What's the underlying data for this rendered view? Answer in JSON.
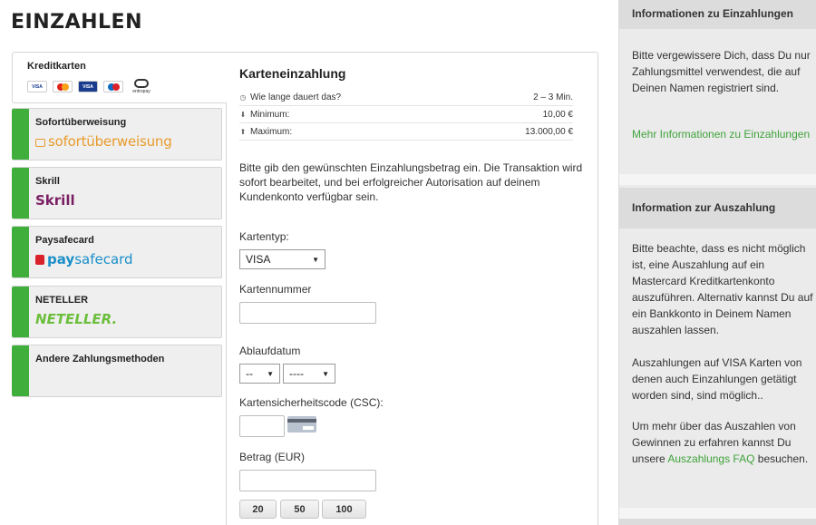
{
  "page": {
    "title": "EINZAHLEN"
  },
  "methods": {
    "active": {
      "label": "Kreditkarten",
      "card_logos": [
        "VISA",
        "Mastercard",
        "VISA Electron",
        "Maestro",
        "entropay"
      ]
    },
    "items": [
      {
        "label": "Sofortüberweisung",
        "logo_text": "sofortüberweisung"
      },
      {
        "label": "Skrill",
        "logo_text": "Skrill"
      },
      {
        "label": "Paysafecard",
        "logo_text_bold": "pay",
        "logo_text_rest": "safecard"
      },
      {
        "label": "NETELLER",
        "logo_text": "NETELLER."
      },
      {
        "label": "Andere Zahlungsmethoden"
      }
    ],
    "accent_color": "#3fae3a"
  },
  "form": {
    "title": "Karteneinzahlung",
    "info": [
      {
        "label": "Wie lange dauert das?",
        "value": "2 – 3 Min.",
        "icon": "clock-icon"
      },
      {
        "label": "Minimum:",
        "value": "10,00 €",
        "icon": "arrow-down-icon"
      },
      {
        "label": "Maximum:",
        "value": "13.000,00 €",
        "icon": "arrow-up-icon"
      }
    ],
    "description": "Bitte gib den gewünschten Einzahlungsbetrag ein. Die Transaktion wird sofort bearbeitet, und bei erfolgreicher Autorisation auf deinem Kundenkonto verfügbar sein.",
    "card_type_label": "Kartentyp:",
    "card_type_value": "VISA",
    "card_number_label": "Kartennummer",
    "card_number_value": "",
    "expiry_label": "Ablaufdatum",
    "expiry_month_value": "--",
    "expiry_year_value": "----",
    "csc_label": "Kartensicherheitscode (CSC):",
    "csc_value": "",
    "amount_label": "Betrag (EUR)",
    "amount_value": "",
    "quick_amounts": [
      "20",
      "50",
      "100"
    ]
  },
  "sidebar": {
    "deposit_info": {
      "title": "Informationen zu Einzahlungen",
      "text": "Bitte vergewissere Dich, dass Du nur Zahlungsmittel verwendest, die auf Deinen Namen registriert sind.",
      "link": "Mehr Informationen zu Einzahlungen"
    },
    "payout_info": {
      "title": "Information zur Auszahlung",
      "text1": "Bitte beachte, dass es nicht möglich ist, eine Auszahlung auf ein Mastercard Kreditkartenkonto auszuführen. Alternativ kannst Du auf ein Bankkonto in Deinem Namen auszahlen lassen.",
      "text2": "Auszahlungen auf VISA Karten von denen auch Einzahlungen getätigt worden sind, sind möglich..",
      "text3_pre": "Um mehr über das Auszahlen von Gewinnen zu erfahren kannst Du unsere ",
      "text3_link": "Auszahlungs FAQ",
      "text3_post": "besuchen."
    },
    "link_color": "#3fa33b"
  }
}
